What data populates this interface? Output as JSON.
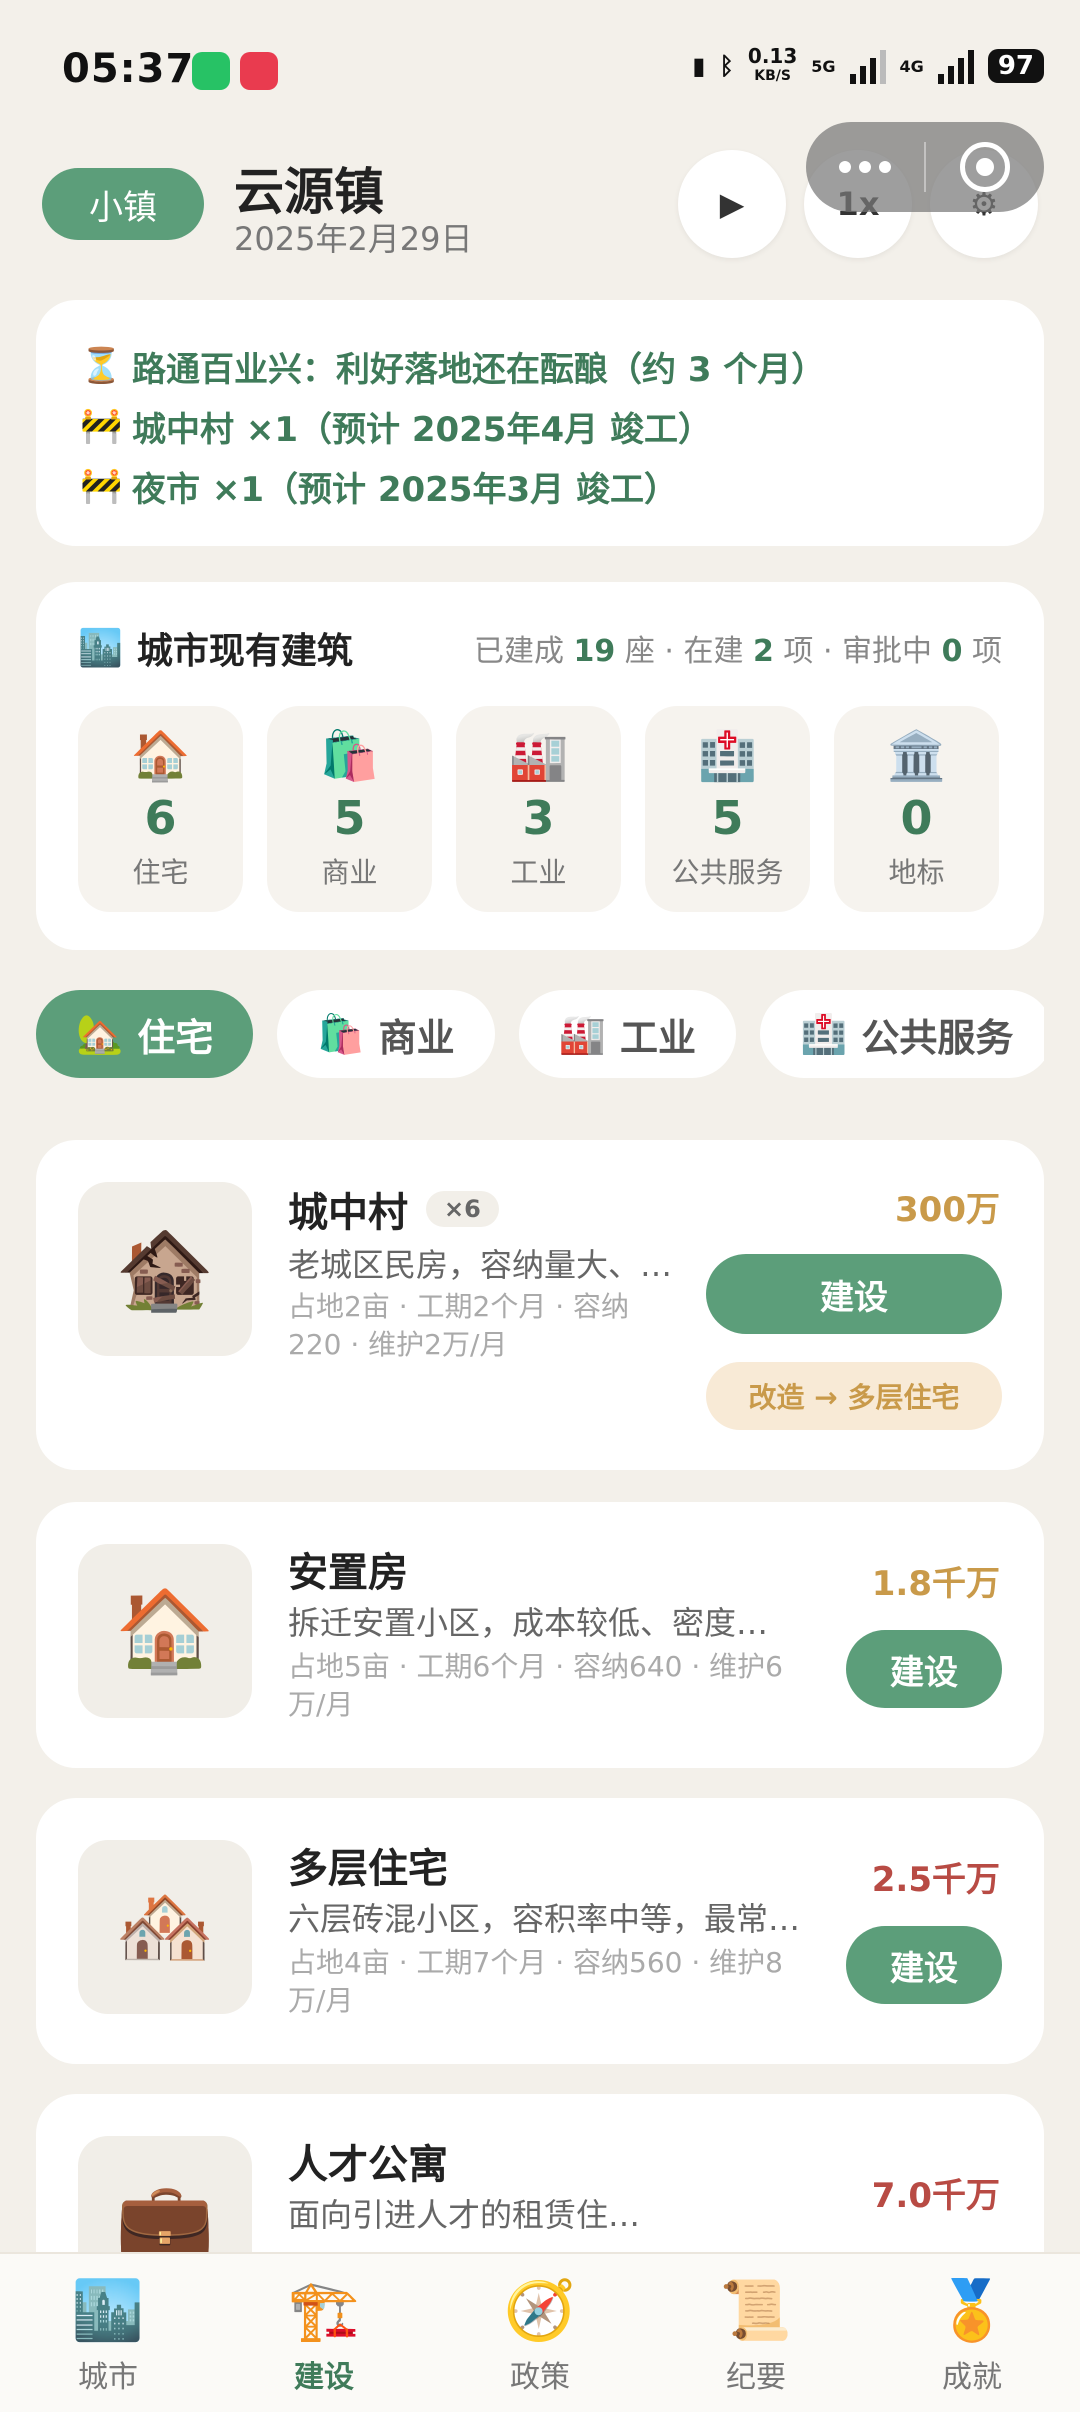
{
  "status_bar": {
    "time": "05:37",
    "net_speed_value": "0.13",
    "net_speed_unit": "KB/S",
    "network_5g": "5G",
    "network_4g": "4G",
    "battery": "97"
  },
  "header": {
    "town_badge": "小镇",
    "town_name": "云源镇",
    "date": "2025年2月29日",
    "play_icon": "▶",
    "speed_label": "1x"
  },
  "news": [
    {
      "icon": "⏳",
      "text": "路通百业兴：利好落地还在酝酿（约 3 个月）"
    },
    {
      "icon": "🚧",
      "text": "城中村 ×1（预计 2025年4月 竣工）"
    },
    {
      "icon": "🚧",
      "text": "夜市 ×1（预计 2025年3月 竣工）"
    }
  ],
  "buildings_summary": {
    "icon": "🏙️",
    "title": "城市现有建筑",
    "built_prefix": "已建成",
    "built_count": "19",
    "built_unit": "座 · 在建",
    "building_count": "2",
    "building_unit": "项 · 审批中",
    "approving_count": "0",
    "approving_unit": "项",
    "tiles": [
      {
        "icon": "🏠",
        "count": "6",
        "label": "住宅"
      },
      {
        "icon": "🛍️",
        "count": "5",
        "label": "商业"
      },
      {
        "icon": "🏭",
        "count": "3",
        "label": "工业"
      },
      {
        "icon": "🏥",
        "count": "5",
        "label": "公共服务"
      },
      {
        "icon": "🏛️",
        "count": "0",
        "label": "地标"
      }
    ]
  },
  "tabs": [
    {
      "icon": "🏡",
      "label": "住宅"
    },
    {
      "icon": "🛍️",
      "label": "商业"
    },
    {
      "icon": "🏭",
      "label": "工业"
    },
    {
      "icon": "🏥",
      "label": "公共服务"
    }
  ],
  "items": [
    {
      "icon": "🏚️",
      "name": "城中村",
      "badge": "×6",
      "desc": "老城区民房，容纳量大、…",
      "meta_line1": "占地2亩 · 工期2个月 · 容纳",
      "meta_line2": "220 · 维护2万/月",
      "price": "300万",
      "build_label": "建设",
      "upgrade_label": "改造 → 多层住宅"
    },
    {
      "icon": "🏠",
      "name": "安置房",
      "desc": "拆迁安置小区，成本较低、密度…",
      "meta_line1": "占地5亩 · 工期6个月 · 容纳640 · 维护6",
      "meta_line2": "万/月",
      "price": "1.8千万",
      "build_label": "建设"
    },
    {
      "icon": "🏘️",
      "name": "多层住宅",
      "desc": "六层砖混小区，容积率中等，最常…",
      "meta_line1": "占地4亩 · 工期7个月 · 容纳560 · 维护8",
      "meta_line2": "万/月",
      "price": "2.5千万",
      "build_label": "建设"
    },
    {
      "icon": "💼",
      "name": "人才公寓",
      "desc": "面向引进人才的租赁住…",
      "price": "7.0千万"
    }
  ],
  "bottom_nav": [
    {
      "icon": "🏙️",
      "label": "城市"
    },
    {
      "icon": "🏗️",
      "label": "建设"
    },
    {
      "icon": "🧭",
      "label": "政策"
    },
    {
      "icon": "📜",
      "label": "纪要"
    },
    {
      "icon": "🏅",
      "label": "成就"
    }
  ],
  "colors": {
    "accent": "#5c9e7a",
    "accent_text": "#3f7b5a",
    "price_gold": "#c99a4a",
    "price_red": "#b84b44",
    "background": "#f3f0ea"
  }
}
